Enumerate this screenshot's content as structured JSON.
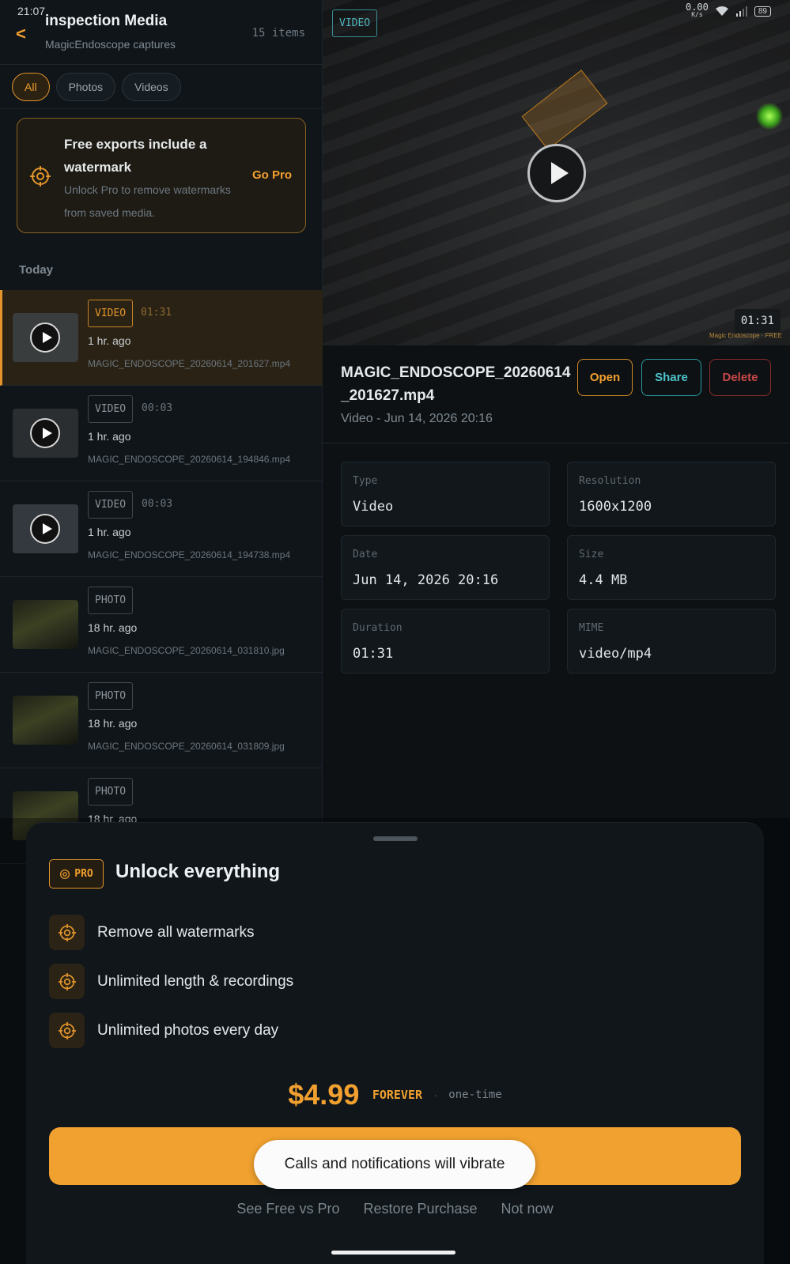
{
  "status": {
    "time": "21:07",
    "speed_value": "0.00",
    "speed_unit": "K/s",
    "battery": "89"
  },
  "header": {
    "back": "<",
    "title": "inspection Media",
    "subtitle": "MagicEndoscope captures",
    "count": "15 items"
  },
  "filters": [
    {
      "label": "All",
      "active": true
    },
    {
      "label": "Photos",
      "active": false
    },
    {
      "label": "Videos",
      "active": false
    }
  ],
  "promo": {
    "title": "Free exports include a watermark",
    "body": "Unlock Pro to remove watermarks from saved media.",
    "action": "Go Pro"
  },
  "section_label": "Today",
  "items": [
    {
      "type": "VIDEO",
      "duration": "01:31",
      "ago": "1 hr. ago",
      "file": "MAGIC_ENDOSCOPE_20260614_201627.mp4",
      "selected": true
    },
    {
      "type": "VIDEO",
      "duration": "00:03",
      "ago": "1 hr. ago",
      "file": "MAGIC_ENDOSCOPE_20260614_194846.mp4",
      "selected": false
    },
    {
      "type": "VIDEO",
      "duration": "00:03",
      "ago": "1 hr. ago",
      "file": "MAGIC_ENDOSCOPE_20260614_194738.mp4",
      "selected": false
    },
    {
      "type": "PHOTO",
      "duration": "",
      "ago": "18 hr. ago",
      "file": "MAGIC_ENDOSCOPE_20260614_031810.jpg",
      "selected": false
    },
    {
      "type": "PHOTO",
      "duration": "",
      "ago": "18 hr. ago",
      "file": "MAGIC_ENDOSCOPE_20260614_031809.jpg",
      "selected": false
    },
    {
      "type": "PHOTO",
      "duration": "",
      "ago": "18 hr. ago",
      "file": "",
      "selected": false
    }
  ],
  "preview": {
    "badge": "VIDEO",
    "timestamp": "01:31",
    "watermark": "Magic Endoscope · FREE"
  },
  "detail": {
    "filename": "MAGIC_ENDOSCOPE_20260614_201627.mp4",
    "meta": "Video - Jun 14, 2026 20:16",
    "actions": {
      "open": "Open",
      "share": "Share",
      "delete": "Delete"
    },
    "fields": [
      {
        "key": "Type",
        "value": "Video"
      },
      {
        "key": "Resolution",
        "value": "1600x1200"
      },
      {
        "key": "Date",
        "value": "Jun 14, 2026 20:16"
      },
      {
        "key": "Size",
        "value": "4.4 MB"
      },
      {
        "key": "Duration",
        "value": "01:31"
      },
      {
        "key": "MIME",
        "value": "video/mp4"
      }
    ]
  },
  "sheet": {
    "badge": "PRO",
    "title": "Unlock everything",
    "features": [
      "Remove all watermarks",
      "Unlimited length & recordings",
      "Unlimited photos every day"
    ],
    "price": "$4.99",
    "price_tag": "FOREVER",
    "price_sep": "·",
    "price_note": "one-time",
    "links": [
      "See Free vs Pro",
      "Restore Purchase",
      "Not now"
    ]
  },
  "toast": "Calls and notifications will vibrate",
  "colors": {
    "accent": "#f0a12f",
    "teal": "#2a9aa2",
    "danger": "#c84848"
  }
}
